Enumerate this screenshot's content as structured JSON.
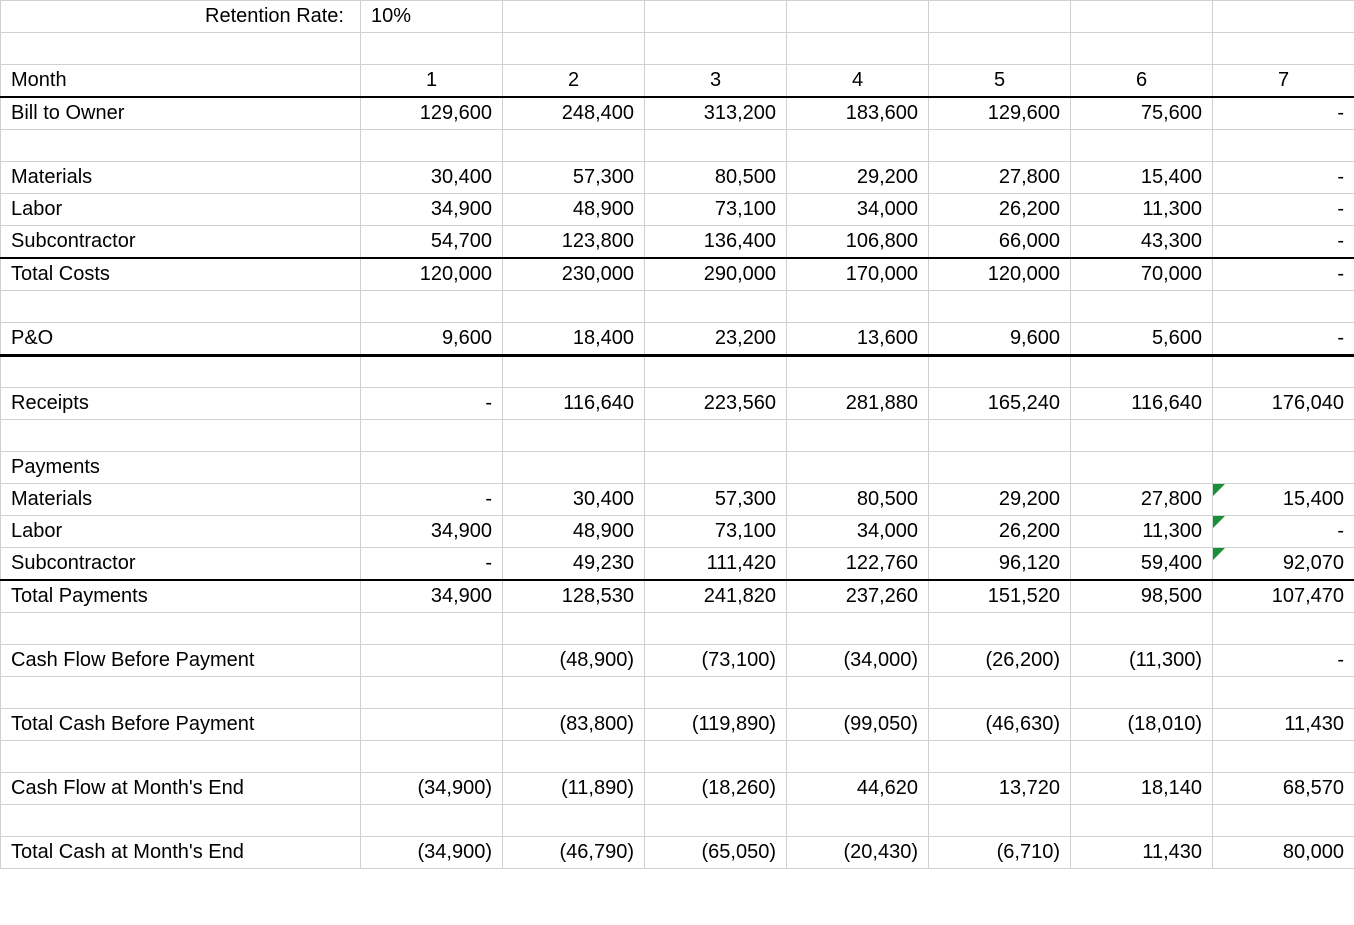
{
  "retention": {
    "label": "Retention Rate:",
    "value": "10%"
  },
  "month_header": {
    "label": "Month",
    "cols": [
      "1",
      "2",
      "3",
      "4",
      "5",
      "6",
      "7"
    ]
  },
  "rows": {
    "bill": {
      "label": "Bill to Owner",
      "v": [
        "129,600",
        "248,400",
        "313,200",
        "183,600",
        "129,600",
        "75,600",
        "-"
      ]
    },
    "materials": {
      "label": "Materials",
      "v": [
        "30,400",
        "57,300",
        "80,500",
        "29,200",
        "27,800",
        "15,400",
        "-"
      ]
    },
    "labor": {
      "label": "Labor",
      "v": [
        "34,900",
        "48,900",
        "73,100",
        "34,000",
        "26,200",
        "11,300",
        "-"
      ]
    },
    "sub": {
      "label": "Subcontractor",
      "v": [
        "54,700",
        "123,800",
        "136,400",
        "106,800",
        "66,000",
        "43,300",
        "-"
      ]
    },
    "totalcosts": {
      "label": "Total Costs",
      "v": [
        "120,000",
        "230,000",
        "290,000",
        "170,000",
        "120,000",
        "70,000",
        "-"
      ]
    },
    "pao": {
      "label": "P&O",
      "v": [
        "9,600",
        "18,400",
        "23,200",
        "13,600",
        "9,600",
        "5,600",
        "-"
      ]
    },
    "receipts": {
      "label": "Receipts",
      "v": [
        "-",
        "116,640",
        "223,560",
        "281,880",
        "165,240",
        "116,640",
        "176,040"
      ]
    },
    "payments_header": {
      "label": "Payments"
    },
    "pmaterials": {
      "label": "Materials",
      "v": [
        "-",
        "30,400",
        "57,300",
        "80,500",
        "29,200",
        "27,800",
        "15,400"
      ]
    },
    "plabor": {
      "label": "Labor",
      "v": [
        "34,900",
        "48,900",
        "73,100",
        "34,000",
        "26,200",
        "11,300",
        "-"
      ]
    },
    "psub": {
      "label": "Subcontractor",
      "v": [
        "-",
        "49,230",
        "111,420",
        "122,760",
        "96,120",
        "59,400",
        "92,070"
      ]
    },
    "totalpay": {
      "label": "Total Payments",
      "v": [
        "34,900",
        "128,530",
        "241,820",
        "237,260",
        "151,520",
        "98,500",
        "107,470"
      ]
    },
    "cfbefore": {
      "label": "Cash Flow Before Payment",
      "v": [
        "",
        "(48,900)",
        "(73,100)",
        "(34,000)",
        "(26,200)",
        "(11,300)",
        "-"
      ]
    },
    "tcbefore": {
      "label": "Total Cash Before Payment",
      "v": [
        "",
        "(83,800)",
        "(119,890)",
        "(99,050)",
        "(46,630)",
        "(18,010)",
        "11,430"
      ]
    },
    "cfend": {
      "label": "Cash Flow at Month's End",
      "v": [
        "(34,900)",
        "(11,890)",
        "(18,260)",
        "44,620",
        "13,720",
        "18,140",
        "68,570"
      ]
    },
    "tcend": {
      "label": "Total Cash at Month's End",
      "v": [
        "(34,900)",
        "(46,790)",
        "(65,050)",
        "(20,430)",
        "(6,710)",
        "11,430",
        "80,000"
      ]
    }
  },
  "flags": {
    "pmaterials": 6,
    "plabor": 6,
    "psub": 6
  }
}
